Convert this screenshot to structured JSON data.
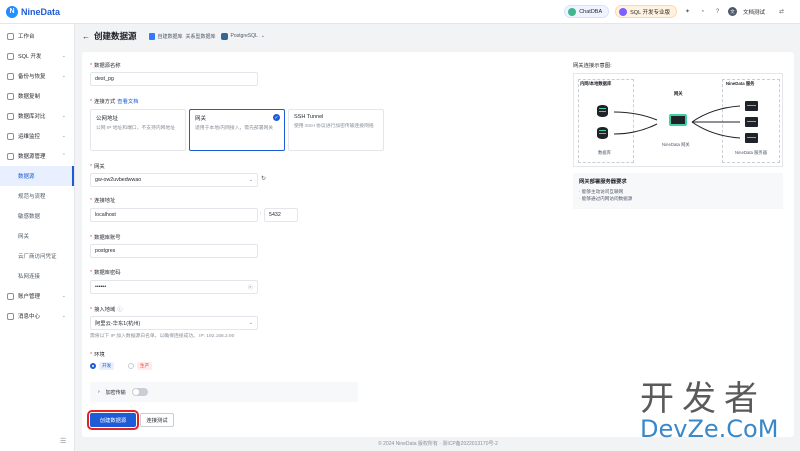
{
  "brand": {
    "name": "NineData"
  },
  "topbar": {
    "chat": "ChatDBA",
    "sql": "SQL 开发专业版",
    "user_initial": "文",
    "user": "文档测试"
  },
  "sidebar": {
    "items": [
      "工作台",
      "SQL 开发",
      "备份与恢复",
      "数据复制",
      "数据库对比",
      "运维监控",
      "数据源管理"
    ],
    "subs": [
      "数据源",
      "规范与流程",
      "敏感数据",
      "网关",
      "云厂商访问凭证",
      "私网连接"
    ],
    "bottom": [
      "账户管理",
      "消息中心"
    ]
  },
  "header": {
    "title": "创建数据源",
    "crumb1": "自建数据库",
    "crumb2": "关系型数据库",
    "crumb3": "PostgreSQL"
  },
  "form": {
    "name_label": "数据源名称",
    "name_value": "dest_pg",
    "conn_label": "连接方式",
    "conn_link": "查看文档",
    "options": [
      {
        "title": "公网地址",
        "desc": "公网 IP 地址和端口，不支持内网地址"
      },
      {
        "title": "网关",
        "desc": "适用于本地/内网接入，需先部署网关"
      },
      {
        "title": "SSH Tunnel",
        "desc": "使用 SSH 协议进行加密传输连接网络"
      }
    ],
    "gateway_label": "网关",
    "gateway_value": "gw-ow2uvbedwwao",
    "addr_label": "连接地址",
    "host": "localhost",
    "port": "5432",
    "user_label": "数据库账号",
    "user_value": "postgres",
    "pwd_label": "数据库密码",
    "pwd_value": "••••••",
    "region_label": "接入地域",
    "region_value": "阿里云-华东1(杭州)",
    "region_hint": "需将以下 IP 加入数据源白名单，以确保连接成功。 IP: 192.168.2.90",
    "env_label": "环境",
    "env_dev": "开发",
    "env_prod": "生产",
    "enc_label": "加密传输",
    "submit": "创建数据源",
    "test": "连接测试"
  },
  "diagram": {
    "title": "网关连接示意图:",
    "left": "内网/本地数据库",
    "right": "NineData 服务",
    "gw_top": "网关",
    "db": "数据库",
    "gw": "NineData 网关",
    "srv": "NineData 服务器"
  },
  "requirements": {
    "title": "网关部署服务器要求",
    "items": [
      "· 能够主动访问互联网",
      "· 能够通过内网访问数据源"
    ]
  },
  "footer": "© 2024 NineData 版权所有 · 浙ICP备2022013170号-2",
  "watermark": {
    "cn": "开发者",
    "en": "DevZe.CoM"
  }
}
